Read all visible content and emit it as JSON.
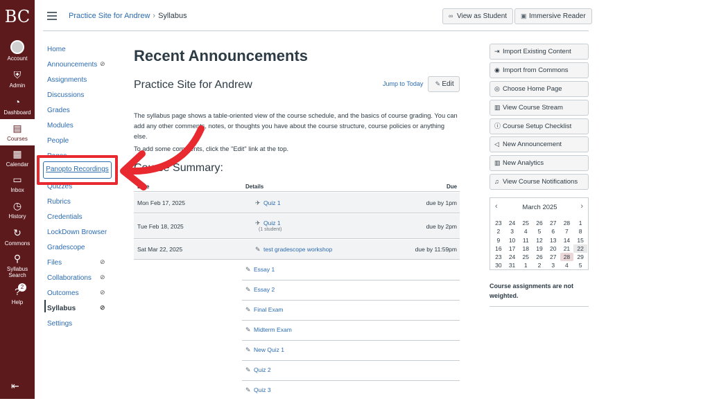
{
  "global_nav": {
    "logo": "BC",
    "items": [
      {
        "label": "Account",
        "icon": "account-icon"
      },
      {
        "label": "Admin",
        "icon": "admin-icon"
      },
      {
        "label": "Dashboard",
        "icon": "dashboard-icon"
      },
      {
        "label": "Courses",
        "icon": "courses-icon"
      },
      {
        "label": "Calendar",
        "icon": "calendar-icon"
      },
      {
        "label": "Inbox",
        "icon": "inbox-icon"
      },
      {
        "label": "History",
        "icon": "history-icon"
      },
      {
        "label": "Commons",
        "icon": "commons-icon"
      },
      {
        "label": "Syllabus",
        "label2": "Search",
        "icon": "search-icon"
      },
      {
        "label": "Help",
        "icon": "help-icon",
        "badge": "2"
      }
    ],
    "collapse_icon": "collapse-nav-icon",
    "bg_color": "#5c1a1d"
  },
  "header": {
    "crumb_course": "Practice Site for Andrew",
    "crumb_page": "Syllabus",
    "view_as_student": "View as Student",
    "immersive_reader": "Immersive Reader"
  },
  "course_nav": {
    "items": [
      {
        "label": "Home"
      },
      {
        "label": "Announcements"
      },
      {
        "label": "Assignments"
      },
      {
        "label": "Discussions"
      },
      {
        "label": "Grades"
      },
      {
        "label": "Modules"
      },
      {
        "label": "People"
      },
      {
        "label": "Pages"
      },
      {
        "label": "Panopto Recordings"
      },
      {
        "label": "Quizzes"
      },
      {
        "label": "Rubrics"
      },
      {
        "label": "Credentials"
      },
      {
        "label": "LockDown Browser"
      },
      {
        "label": "Gradescope"
      },
      {
        "label": "Files"
      },
      {
        "label": "Collaborations"
      },
      {
        "label": "Outcomes"
      },
      {
        "label": "Syllabus"
      },
      {
        "label": "Settings"
      }
    ]
  },
  "main": {
    "title": "Recent Announcements",
    "course_title": "Practice Site for Andrew",
    "jump_to_today": "Jump to Today",
    "edit": "Edit",
    "description": "The syllabus page shows a table-oriented view of the course schedule, and the basics of course grading. You can add any other comments, notes, or thoughts you have about the course structure, course policies or anything else.",
    "hint": "To add some comments, click the \"Edit\" link at the top.",
    "summary_heading": "Course Summary:",
    "table": {
      "headers": {
        "date": "Date",
        "details": "Details",
        "due": "Due"
      },
      "dated_rows": [
        {
          "date": "Mon Feb 17, 2025",
          "name": "Quiz 1",
          "sub": "",
          "due": "due by 1pm",
          "icon": "rocket-icon"
        },
        {
          "date": "Tue Feb 18, 2025",
          "name": "Quiz 1",
          "sub": "(1 student)",
          "due": "due by 2pm",
          "icon": "rocket-icon"
        },
        {
          "date": "Sat Mar 22, 2025",
          "name": "test gradescope workshop",
          "sub": "",
          "due": "due by 11:59pm",
          "icon": "assignment-icon"
        }
      ],
      "undated_rows": [
        "Essay 1",
        "Essay 2",
        "Final Exam",
        "Midterm Exam",
        "New Quiz 1",
        "Quiz 2",
        "Quiz 3"
      ]
    }
  },
  "right": {
    "buttons": [
      {
        "label": "Import Existing Content",
        "icon": "import-icon"
      },
      {
        "label": "Import from Commons",
        "icon": "commons-icon"
      },
      {
        "label": "Choose Home Page",
        "icon": "target-icon"
      },
      {
        "label": "View Course Stream",
        "icon": "stream-icon"
      },
      {
        "label": "Course Setup Checklist",
        "icon": "question-icon"
      },
      {
        "label": "New Announcement",
        "icon": "megaphone-icon"
      },
      {
        "label": "New Analytics",
        "icon": "analytics-icon"
      },
      {
        "label": "View Course Notifications",
        "icon": "bell-icon"
      }
    ],
    "calendar": {
      "title": "March 2025",
      "days": [
        "23",
        "24",
        "25",
        "26",
        "27",
        "28",
        "1",
        "2",
        "3",
        "4",
        "5",
        "6",
        "7",
        "8",
        "9",
        "10",
        "11",
        "12",
        "13",
        "14",
        "15",
        "16",
        "17",
        "18",
        "19",
        "20",
        "21",
        "22",
        "23",
        "24",
        "25",
        "26",
        "27",
        "28",
        "29",
        "30",
        "31",
        "1",
        "2",
        "3",
        "4",
        "5"
      ],
      "today_index": 33,
      "selected_index": 27
    },
    "weighted_note": "Course assignments are not weighted."
  },
  "annotation_color": "#e8292f"
}
